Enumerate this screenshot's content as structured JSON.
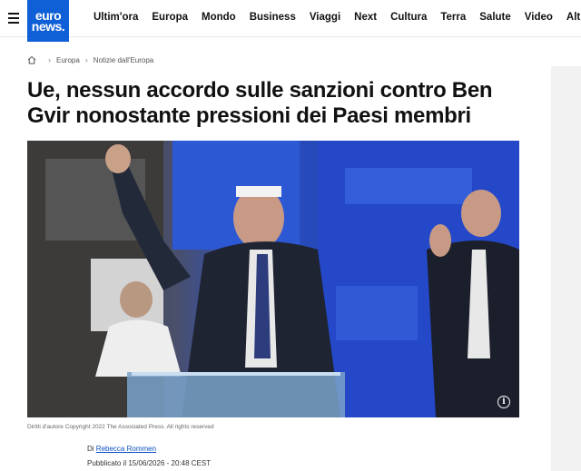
{
  "header": {
    "logo_line1": "euro",
    "logo_line2": "news.",
    "nav": [
      "Ultim'ora",
      "Europa",
      "Mondo",
      "Business",
      "Viaggi",
      "Next",
      "Cultura",
      "Terra",
      "Salute",
      "Video",
      "Altre"
    ]
  },
  "breadcrumb": {
    "items": [
      "Europa",
      "Notizie dall'Europa"
    ]
  },
  "article": {
    "title": "Ue, nessun accordo sulle sanzioni contro Ben Gvir nonostante pressioni dei Paesi membri",
    "caption": "Diritti d'autore Copyright 2022 The Associated Press. All rights reserved",
    "byline_prefix": "Di",
    "author": "Rebecca Rommen",
    "published": "Pubblicato il 15/06/2026 - 20:48 CEST"
  },
  "colors": {
    "brand": "#0f5fd6",
    "link": "#0b4fc2"
  },
  "icons": {
    "menu": "hamburger-icon",
    "home": "home-icon",
    "info": "info-icon"
  }
}
